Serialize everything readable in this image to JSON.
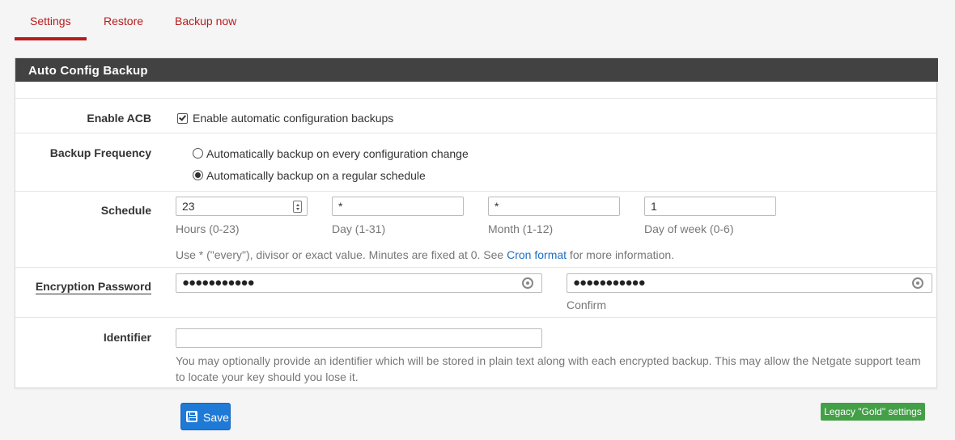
{
  "tabs": [
    {
      "label": "Settings",
      "active": true
    },
    {
      "label": "Restore",
      "active": false
    },
    {
      "label": "Backup now",
      "active": false
    }
  ],
  "panel": {
    "title": "Auto Config Backup"
  },
  "enable_acb": {
    "label": "Enable ACB",
    "checkbox_label": "Enable automatic configuration backups",
    "checked": true
  },
  "backup_frequency": {
    "label": "Backup Frequency",
    "options": [
      {
        "label": "Automatically backup on every configuration change",
        "selected": false
      },
      {
        "label": "Automatically backup on a regular schedule",
        "selected": true
      }
    ]
  },
  "schedule": {
    "label": "Schedule",
    "fields": [
      {
        "value": "23",
        "help": "Hours (0-23)"
      },
      {
        "value": "*",
        "help": "Day (1-31)"
      },
      {
        "value": "*",
        "help": "Month (1-12)"
      },
      {
        "value": "1",
        "help": "Day of week (0-6)"
      }
    ],
    "help_before": "Use * (\"every\"), divisor or exact value. Minutes are fixed at 0. See ",
    "help_link": "Cron format",
    "help_after": " for more information."
  },
  "encryption": {
    "label": "Encryption Password",
    "password_masked": "●●●●●●●●●●●",
    "confirm_masked": "●●●●●●●●●●●",
    "confirm_help": "Confirm"
  },
  "identifier": {
    "label": "Identifier",
    "value": "",
    "help_line1": "You may optionally provide an identifier which will be stored in plain text along with each encrypted backup. This may allow the Netgate support team",
    "help_line2": "to locate your key should you lose it."
  },
  "buttons": {
    "save": "Save",
    "legacy": "Legacy \"Gold\" settings"
  },
  "colors": {
    "accent_red": "#b71c1c",
    "heading_bg": "#424242",
    "save_blue": "#1e7ad6",
    "legacy_green": "#43a047",
    "link_blue": "#1e6ebf"
  }
}
